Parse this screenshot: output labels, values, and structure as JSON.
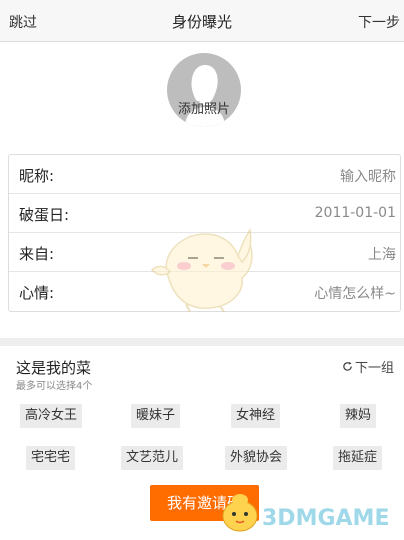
{
  "topbar": {
    "skip_label": "跳过",
    "title": "身份曝光",
    "next_label": "下一步"
  },
  "avatar": {
    "add_label": "添加照片"
  },
  "form": {
    "rows": [
      {
        "label": "昵称:",
        "value": "输入昵称"
      },
      {
        "label": "破蛋日:",
        "value": "2011-01-01"
      },
      {
        "label": "来自:",
        "value": "上海"
      },
      {
        "label": "心情:",
        "value": "心情怎么样~"
      }
    ]
  },
  "tags_section": {
    "title": "这是我的菜",
    "subtitle": "最多可以选择4个",
    "refresh_label": "下一组",
    "tags": [
      "高冷女王",
      "暖妹子",
      "女神经",
      "辣妈",
      "宅宅宅",
      "文艺范儿",
      "外貌协会",
      "拖延症"
    ]
  },
  "invite_button": "我有邀请码",
  "watermark": {
    "text": "3DMGAME"
  },
  "colors": {
    "accent": "#ff6d00",
    "tag_bg": "#ebebeb",
    "avatar_bg": "#bdbdbd"
  }
}
